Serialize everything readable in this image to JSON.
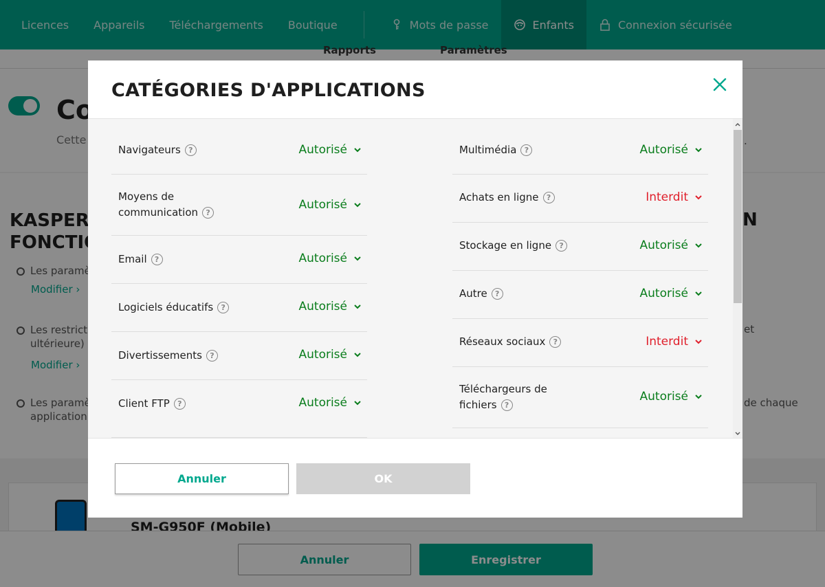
{
  "nav": {
    "items": [
      "Licences",
      "Appareils",
      "Téléchargements",
      "Boutique"
    ],
    "right_items": [
      {
        "label": "Mots de passe",
        "icon": "key-icon"
      },
      {
        "label": "Enfants",
        "icon": "kids-icon"
      },
      {
        "label": "Connexion sécurisée",
        "icon": "lock-icon"
      }
    ]
  },
  "background": {
    "subtab_left": "Rapports",
    "subtab_right": "Paramètres",
    "section_title": "Co",
    "section_sub": "Cette",
    "heading_line1": "KASPERS",
    "heading_line2": "FONCTIO",
    "heading_right": "N",
    "bullet1": "Les paramè",
    "bullet2_line1": "Les restrict",
    "bullet2_line2": "ultérieure)",
    "bullet3_line1": "Les paramè",
    "bullet3_line2": "application",
    "modify_link": "Modifier",
    "right_txt1": ".",
    "right_txt2": "et",
    "right_txt3": "de chaque",
    "device_name": "SM-G950F (Mobile)",
    "cancel_label": "Annuler",
    "save_label": "Enregistrer"
  },
  "modal": {
    "title": "CATÉGORIES D'APPLICATIONS",
    "cancel_label": "Annuler",
    "ok_label": "OK",
    "left_categories": [
      {
        "label": "Navigateurs",
        "status": "Autorisé"
      },
      {
        "label": "Moyens de communication",
        "status": "Autorisé"
      },
      {
        "label": "Email",
        "status": "Autorisé"
      },
      {
        "label": "Logiciels éducatifs",
        "status": "Autorisé"
      },
      {
        "label": "Divertissements",
        "status": "Autorisé"
      },
      {
        "label": "Client FTP",
        "status": "Autorisé"
      }
    ],
    "right_categories": [
      {
        "label": "Multimédia",
        "status": "Autorisé"
      },
      {
        "label": "Achats en ligne",
        "status": "Interdit"
      },
      {
        "label": "Stockage en ligne",
        "status": "Autorisé"
      },
      {
        "label": "Autre",
        "status": "Autorisé"
      },
      {
        "label": "Réseaux sociaux",
        "status": "Interdit"
      },
      {
        "label": "Téléchargeurs de fichiers",
        "status": "Autorisé"
      }
    ]
  },
  "colors": {
    "brand": "#00a88e",
    "allowed": "#0a7d1c",
    "forbidden": "#e0202c"
  }
}
